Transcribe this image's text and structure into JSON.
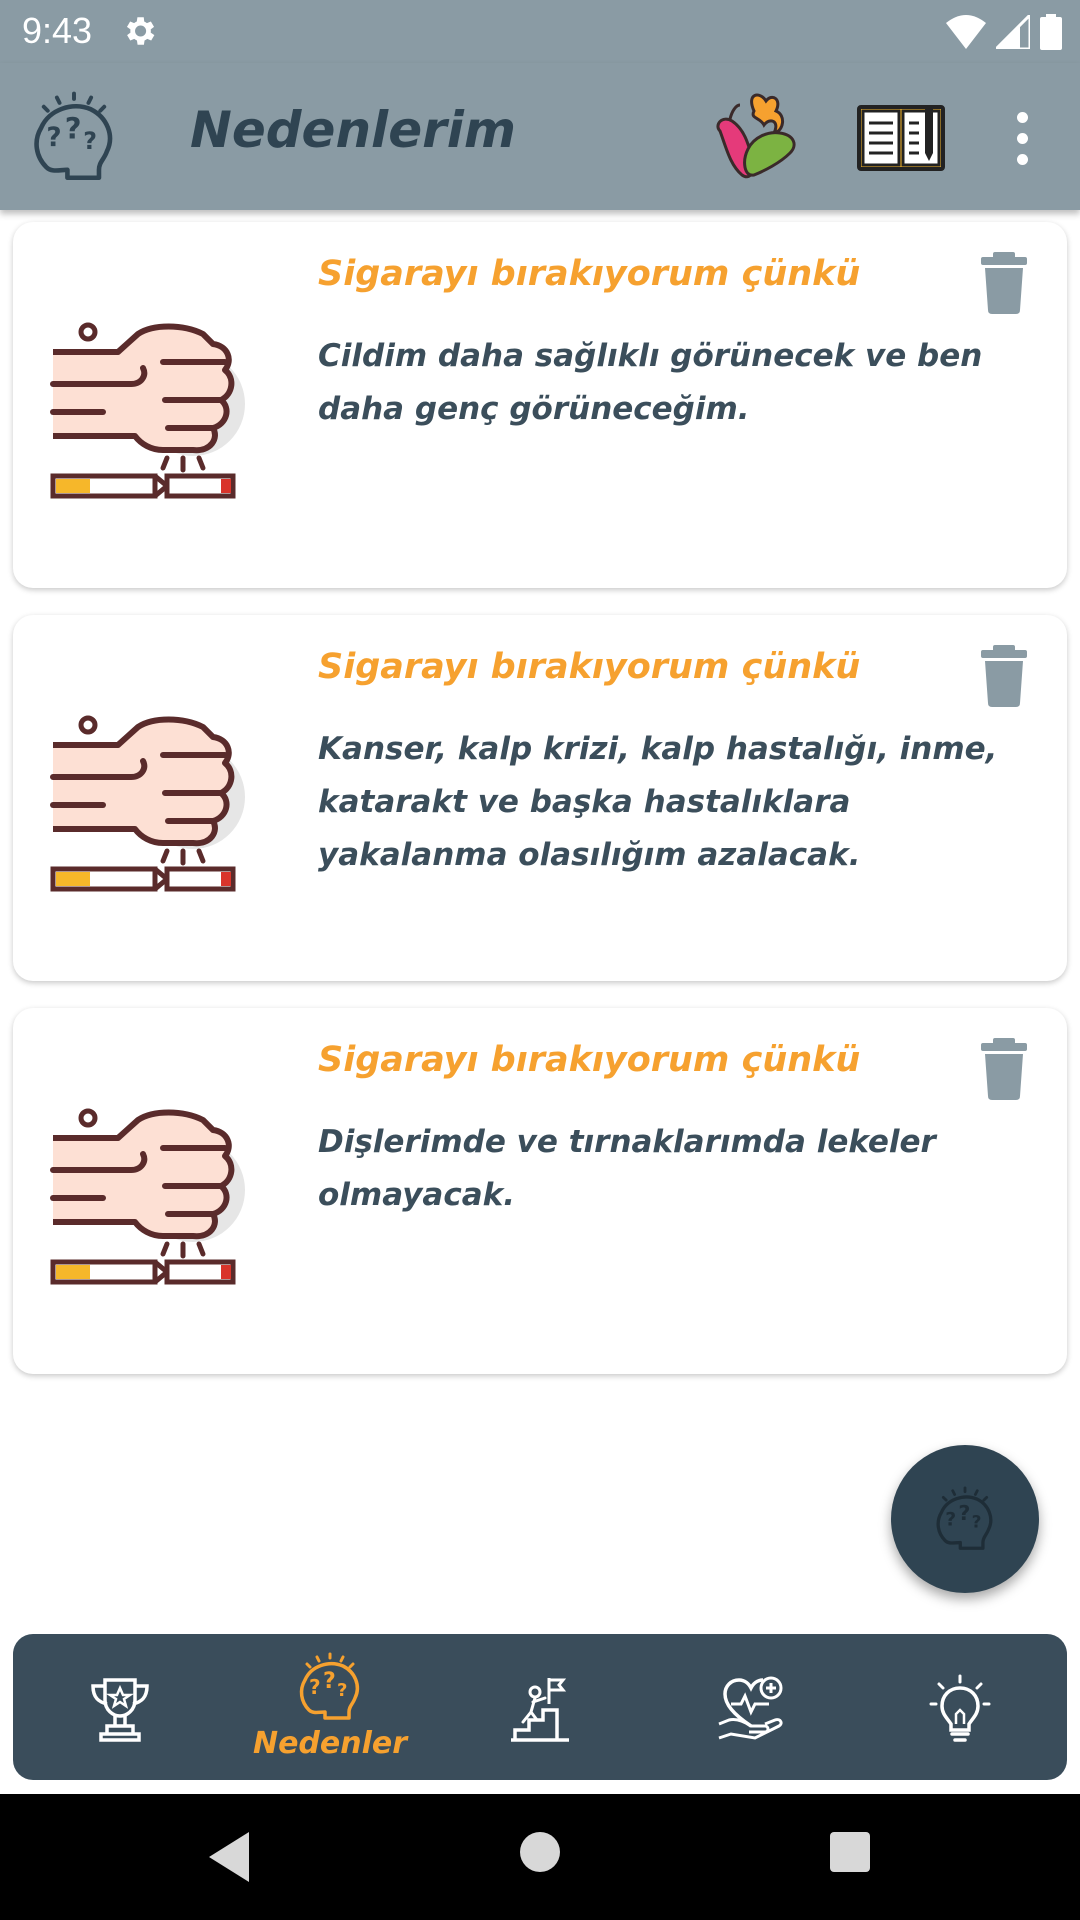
{
  "status_bar": {
    "time": "9:43",
    "icons": [
      "settings-gear-icon",
      "wifi-icon",
      "signal-icon",
      "battery-icon"
    ]
  },
  "app_bar": {
    "title": "Nedenlerim",
    "logo_icon": "thinking-head-icon",
    "actions": [
      "peppers-icon",
      "journal-icon",
      "more-options-icon"
    ]
  },
  "reasons": {
    "heading": "Sigarayı bırakıyorum çünkü",
    "items": [
      {
        "text": "Cildim daha sağlıklı görünecek ve ben daha genç görüneceğim."
      },
      {
        "text": "Kanser, kalp krizi, kalp hastalığı, inme, katarakt ve başka hastalıklara yakalanma olasılığım azalacak."
      },
      {
        "text": "Dişlerimde ve tırnaklarımda lekeler olmayacak."
      }
    ],
    "item_icon": "fist-breaking-cigarette-icon",
    "delete_icon": "trash-icon"
  },
  "fab": {
    "icon": "add-reason-thinking-head-icon"
  },
  "bottom_nav": {
    "items": [
      {
        "icon": "trophy-icon",
        "label": ""
      },
      {
        "icon": "thinking-head-icon",
        "label": "Nedenler",
        "active": true
      },
      {
        "icon": "climber-stairs-icon",
        "label": ""
      },
      {
        "icon": "health-heart-hand-icon",
        "label": ""
      },
      {
        "icon": "lightbulb-icon",
        "label": ""
      }
    ]
  },
  "colors": {
    "app_bar": "#8a9ba4",
    "accent": "#f6a12f",
    "text_dark": "#3b4e5b",
    "nav_bg": "#3a4d5b",
    "trash": "#8a9ba4"
  }
}
